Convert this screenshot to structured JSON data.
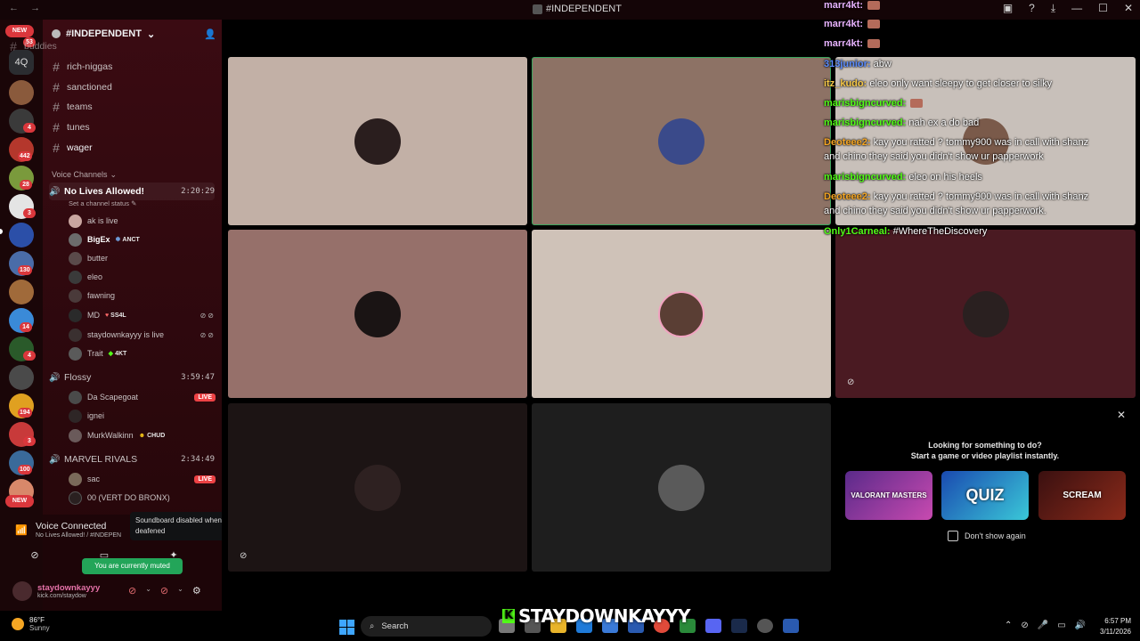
{
  "titlebar": {
    "title": "#INDEPENDENT",
    "back": "←",
    "forward": "→"
  },
  "rail": {
    "new_top": "NEW",
    "new_bottom": "NEW",
    "badges": [
      "53",
      "4",
      "442",
      "28",
      "3",
      "130",
      "14",
      "4",
      "194",
      "3",
      "100"
    ],
    "folder_label": "4Q"
  },
  "guild": {
    "name": "#INDEPENDENT"
  },
  "channels": [
    "buddies",
    "rich-niggas",
    "sanctioned",
    "teams",
    "tunes",
    "wager"
  ],
  "voice_section_label": "Voice Channels",
  "voice_channels": [
    {
      "name": "No Lives Allowed!",
      "timer": "2:20:29",
      "status": "Set a channel status"
    },
    {
      "name": "Flossy",
      "timer": "3:59:47"
    },
    {
      "name": "MARVEL RIVALS",
      "timer": "2:34:49"
    }
  ],
  "members_nla": [
    {
      "name": "ak is live"
    },
    {
      "name": "BigEx",
      "tag": "ANCT"
    },
    {
      "name": "butter"
    },
    {
      "name": "eleo"
    },
    {
      "name": "fawning"
    },
    {
      "name": "MD",
      "tag": "SS4L"
    },
    {
      "name": "staydownkayyy is live"
    },
    {
      "name": "Trait",
      "tag": "4KT"
    }
  ],
  "members_flossy": [
    {
      "name": "Da Scapegoat",
      "live": "LIVE"
    },
    {
      "name": "ignei"
    },
    {
      "name": "MurkWalkinn",
      "tag": "CHUD"
    }
  ],
  "members_marvel": [
    {
      "name": "sac",
      "live": "LIVE"
    },
    {
      "name": "00 (VERT DO BRONX)"
    }
  ],
  "voice_panel": {
    "title": "Voice Connected",
    "subtitle": "No Lives Allowed! / #INDEPEN",
    "tooltip": "Soundboard disabled when deafened",
    "toast": "You are currently muted"
  },
  "user": {
    "name": "staydownkayyy",
    "status": "kick.com/staydow"
  },
  "chat": [
    {
      "name": "marr4kt:",
      "text": "",
      "color": "#e8b3ff"
    },
    {
      "name": "marr4kt:",
      "text": "",
      "color": "#e8b3ff"
    },
    {
      "name": "marr4kt:",
      "text": "",
      "color": "#e8b3ff"
    },
    {
      "name": "313junior:",
      "text": "abw",
      "color": "#5a8cff"
    },
    {
      "name": "itz_kudo:",
      "text": "eleo only want sleepy to get closer to silky",
      "color": "#f7c948"
    },
    {
      "name": "marisbigncurved:",
      "text": "",
      "color": "#53fc18"
    },
    {
      "name": "marisbigncurved:",
      "text": "nah ex a do bad",
      "color": "#53fc18"
    },
    {
      "name": "Deoteee2:",
      "text": "kay you ratted ? tommy900 was in call with shanz",
      "color": "#f5a623"
    },
    {
      "name": "",
      "text": "and chino they said you didn't show ur papperwork",
      "color": "#fff"
    },
    {
      "name": "marisbigncurved:",
      "text": "eleo on his heels",
      "color": "#53fc18"
    },
    {
      "name": "Deoteee2:",
      "text": "kay you ratted ? tommy900 was in call with shanz",
      "color": "#f5a623"
    },
    {
      "name": "",
      "text": "and chino they said you didn't show ur papperwork.",
      "color": "#fff"
    },
    {
      "name": "Only1Carneal:",
      "text": "#WhereTheDiscovery",
      "color": "#53fc18"
    }
  ],
  "activity": {
    "line1": "Looking for something to do?",
    "line2": "Start a game or video playlist instantly.",
    "cards": [
      "VALORANT MASTERS",
      "QUIZ",
      "SCREAM"
    ],
    "dont_show": "Don't show again"
  },
  "overlay_name": "STAYDOWNKAYYY",
  "taskbar": {
    "temp": "86°F",
    "weather": "Sunny",
    "search": "Search",
    "time": "6:57 PM",
    "date": "3/11/2026"
  }
}
